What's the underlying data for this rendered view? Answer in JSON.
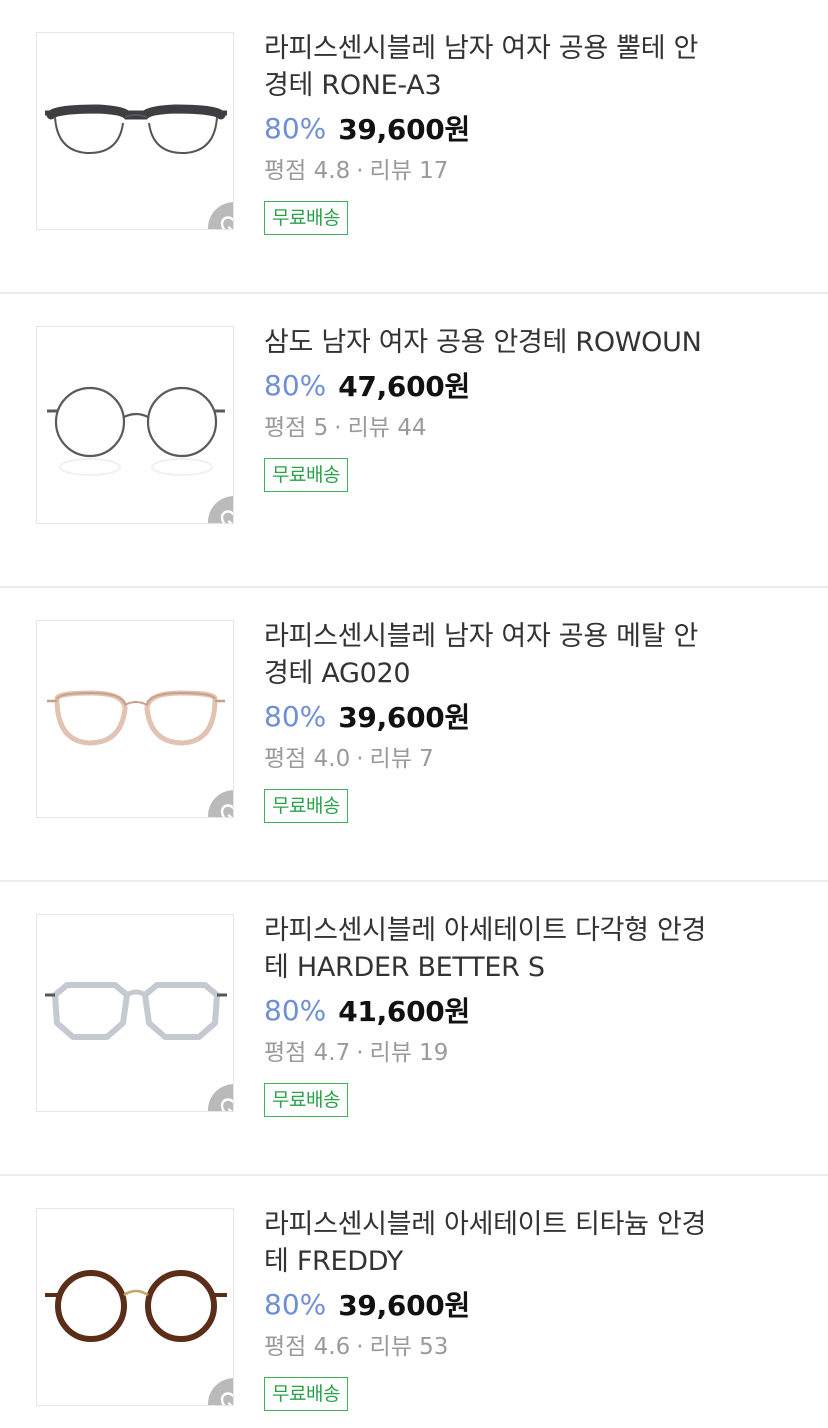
{
  "products": [
    {
      "title": "라피스센시블레 남자 여자 공용 뿔테 안경테 RONE-A3",
      "discount": "80%",
      "price": "39,600원",
      "rating_label": "평점 4.8",
      "review_label": "리뷰 17",
      "badge": "무료배송",
      "frame_color": "#3d3d42",
      "rim_color": "#55555a",
      "style": "browline"
    },
    {
      "title": "삼도 남자 여자 공용 안경테 ROWOUN",
      "discount": "80%",
      "price": "47,600원",
      "rating_label": "평점 5",
      "review_label": "리뷰 44",
      "badge": "무료배송",
      "frame_color": "#5a5a5e",
      "rim_color": "#6b6b70",
      "style": "round-metal"
    },
    {
      "title": "라피스센시블레 남자 여자 공용 메탈 안경테 AG020",
      "discount": "80%",
      "price": "39,600원",
      "rating_label": "평점 4.0",
      "review_label": "리뷰 7",
      "badge": "무료배송",
      "frame_color": "#c9a08a",
      "rim_color": "#e2c2b2",
      "style": "panto-metal"
    },
    {
      "title": "라피스센시블레 아세테이트 다각형 안경테 HARDER BETTER S",
      "discount": "80%",
      "price": "41,600원",
      "rating_label": "평점 4.7",
      "review_label": "리뷰 19",
      "badge": "무료배송",
      "frame_color": "#d9dde4",
      "rim_color": "#c4c9d2",
      "style": "polygon-clear"
    },
    {
      "title": "라피스센시블레 아세테이트 티타늄 안경테 FREDDY",
      "discount": "80%",
      "price": "39,600원",
      "rating_label": "평점 4.6",
      "review_label": "리뷰 53",
      "badge": "무료배송",
      "frame_color": "#5b2e1a",
      "rim_color": "#3a1d10",
      "style": "round-acetate"
    }
  ],
  "icons": {
    "wish": "heart-check-icon",
    "separator": "·"
  },
  "colors": {
    "discount": "#6e8fd8",
    "badge": "#2aa24a",
    "meta": "#9a9a9a"
  }
}
